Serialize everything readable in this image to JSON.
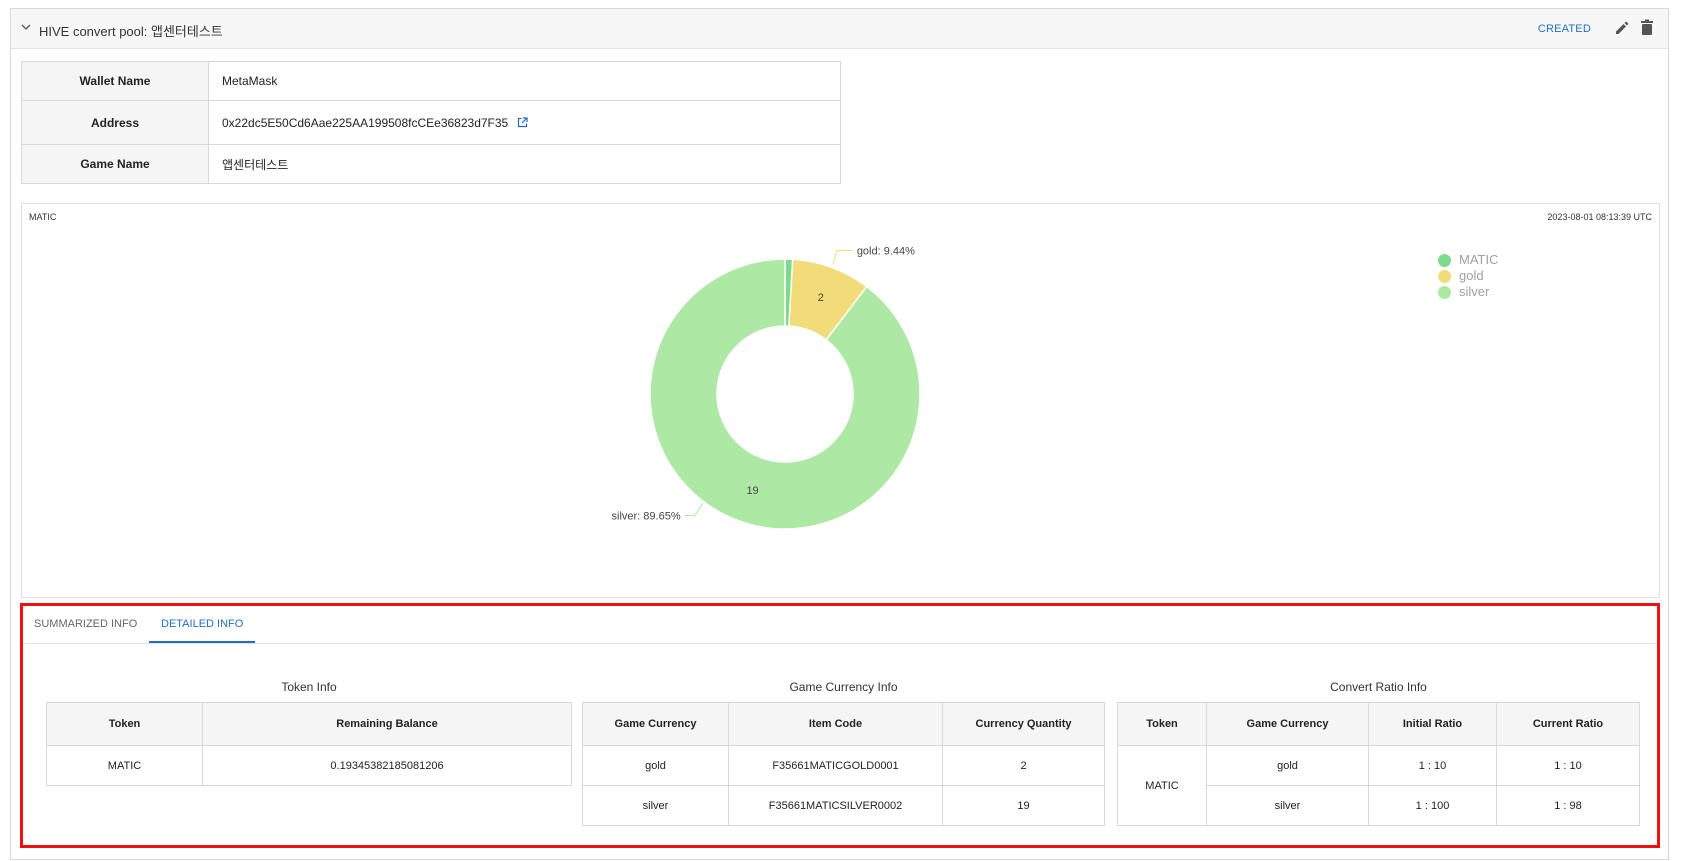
{
  "header": {
    "title": "HIVE convert pool: 앱센터테스트",
    "status": "CREATED",
    "icons": {
      "collapse": "chevron-down-icon",
      "edit": "pencil-icon",
      "delete": "trash-icon"
    }
  },
  "wallet": {
    "rows": [
      {
        "label": "Wallet Name",
        "value": "MetaMask"
      },
      {
        "label": "Address",
        "value": "0x22dc5E50Cd6Aae225AA199508fcCEe36823d7F35"
      },
      {
        "label": "Game Name",
        "value": "앱센터테스트"
      }
    ]
  },
  "chart": {
    "title": "MATIC",
    "timestamp": "2023-08-01 08:13:39 UTC",
    "legend": [
      {
        "name": "MATIC",
        "color": "#7fd98a"
      },
      {
        "name": "gold",
        "color": "#f2dc7a"
      },
      {
        "name": "silver",
        "color": "#aee8a5"
      }
    ],
    "labels": {
      "gold": "gold: 9.44%",
      "silver": "silver: 89.65%"
    }
  },
  "chart_data": {
    "type": "pie",
    "variant": "donut",
    "title": "MATIC",
    "categories": [
      "MATIC",
      "gold",
      "silver"
    ],
    "values": [
      0.19345382185081206,
      2,
      19
    ],
    "percent_labels": {
      "gold": "9.44%",
      "silver": "89.65%"
    },
    "value_labels": {
      "gold": "2",
      "silver": "19"
    },
    "colors": [
      "#7fd98a",
      "#f2dc7a",
      "#aee8a5"
    ],
    "legend_position": "top-right"
  },
  "tabs": [
    {
      "label": "SUMMARIZED INFO",
      "active": false
    },
    {
      "label": "DETAILED INFO",
      "active": true
    }
  ],
  "token_info": {
    "title": "Token Info",
    "headers": [
      "Token",
      "Remaining Balance"
    ],
    "rows": [
      [
        "MATIC",
        "0.19345382185081206"
      ]
    ]
  },
  "game_currency_info": {
    "title": "Game Currency Info",
    "headers": [
      "Game Currency",
      "Item Code",
      "Currency Quantity"
    ],
    "rows": [
      [
        "gold",
        "F35661MATICGOLD0001",
        "2"
      ],
      [
        "silver",
        "F35661MATICSILVER0002",
        "19"
      ]
    ]
  },
  "convert_ratio_info": {
    "title": "Convert Ratio Info",
    "headers": [
      "Token",
      "Game Currency",
      "Initial Ratio",
      "Current Ratio"
    ],
    "token": "MATIC",
    "rows": [
      [
        "gold",
        "1 : 10",
        "1 : 10"
      ],
      [
        "silver",
        "1 : 100",
        "1 : 98"
      ]
    ]
  }
}
